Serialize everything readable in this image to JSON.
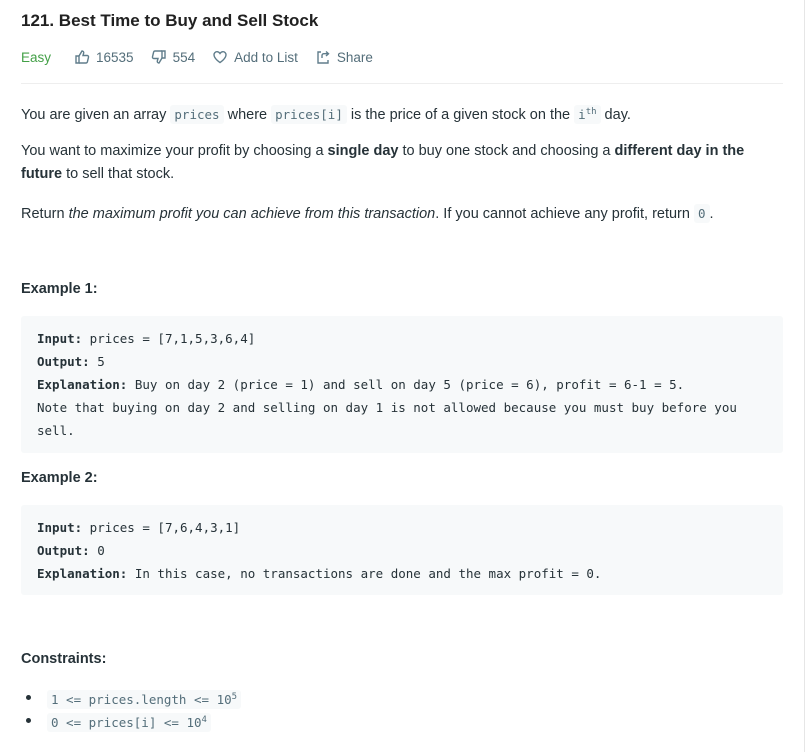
{
  "problem": {
    "title": "121. Best Time to Buy and Sell Stock",
    "difficulty": "Easy",
    "likes": "16535",
    "dislikes": "554",
    "add_to_list": "Add to List",
    "share": "Share"
  },
  "description": {
    "p1": {
      "t1": "You are given an array ",
      "c1": "prices",
      "t2": " where ",
      "c2": "prices[i]",
      "t3": " is the price of a given stock on the ",
      "c3_base": "i",
      "c3_sup": "th",
      "t4": " day."
    },
    "p2": {
      "t1": "You want to maximize your profit by choosing a ",
      "b1": "single day",
      "t2": " to buy one stock and choosing a ",
      "b2": "different day in the future",
      "t3": " to sell that stock."
    },
    "p3": {
      "t1": "Return ",
      "i1": "the maximum profit you can achieve from this transaction",
      "t2": ". If you cannot achieve any profit, return ",
      "c1": "0",
      "t3": "."
    }
  },
  "examples": [
    {
      "heading": "Example 1:",
      "input_label": "Input:",
      "input": " prices = [7,1,5,3,6,4]",
      "output_label": "Output:",
      "output": " 5",
      "explanation_label": "Explanation:",
      "explanation": " Buy on day 2 (price = 1) and sell on day 5 (price = 6), profit = 6-1 = 5.\nNote that buying on day 2 and selling on day 1 is not allowed because you must buy before you sell."
    },
    {
      "heading": "Example 2:",
      "input_label": "Input:",
      "input": " prices = [7,6,4,3,1]",
      "output_label": "Output:",
      "output": " 0",
      "explanation_label": "Explanation:",
      "explanation": " In this case, no transactions are done and the max profit = 0."
    }
  ],
  "constraints": {
    "heading": "Constraints:",
    "items": [
      {
        "base": "1 <= prices.length <= 10",
        "sup": "5"
      },
      {
        "base": "0 <= prices[i] <= 10",
        "sup": "4"
      }
    ]
  }
}
